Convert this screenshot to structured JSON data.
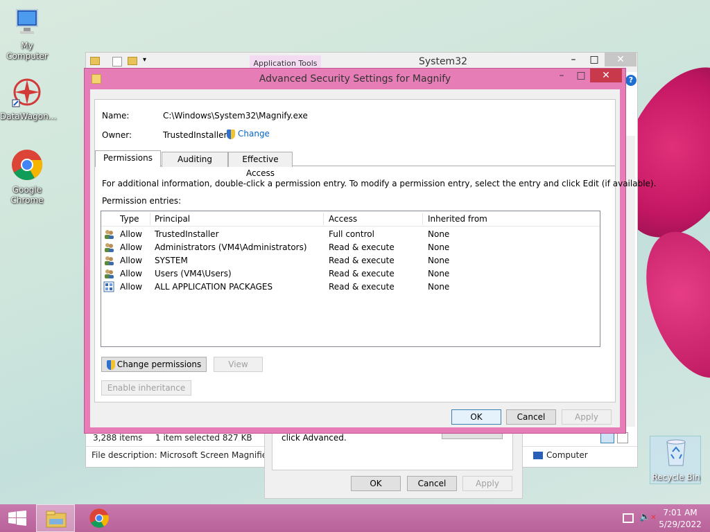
{
  "desktop": {
    "icons": [
      {
        "label": "My Computer",
        "icon": "computer-icon"
      },
      {
        "label": "DataWagon…",
        "icon": "datawagon-icon"
      },
      {
        "label": "Google Chrome",
        "icon": "chrome-icon"
      },
      {
        "label": "Recycle Bin",
        "icon": "recycle-bin-icon"
      }
    ]
  },
  "explorer": {
    "title": "System32",
    "ribbon_context": "Application Tools",
    "status_items": "3,288 items",
    "status_selected": "1 item selected  827 KB",
    "file_description": "File description: Microsoft Screen Magnifier, Co",
    "location": "Computer"
  },
  "properties_dialog": {
    "hint": "click Advanced.",
    "ok": "OK",
    "cancel": "Cancel",
    "apply": "Apply"
  },
  "dialog": {
    "title": "Advanced Security Settings for Magnify",
    "name_label": "Name:",
    "name_value": "C:\\Windows\\System32\\Magnify.exe",
    "owner_label": "Owner:",
    "owner_value": "TrustedInstaller",
    "change_link": "Change",
    "tabs": [
      "Permissions",
      "Auditing",
      "Effective Access"
    ],
    "info": "For additional information, double-click a permission entry. To modify a permission entry, select the entry and click Edit (if available).",
    "entries_label": "Permission entries:",
    "columns": [
      "Type",
      "Principal",
      "Access",
      "Inherited from"
    ],
    "rows": [
      {
        "type": "Allow",
        "principal": "TrustedInstaller",
        "access": "Full control",
        "inherited": "None",
        "icon": "users-icon"
      },
      {
        "type": "Allow",
        "principal": "Administrators (VM4\\Administrators)",
        "access": "Read & execute",
        "inherited": "None",
        "icon": "users-icon"
      },
      {
        "type": "Allow",
        "principal": "SYSTEM",
        "access": "Read & execute",
        "inherited": "None",
        "icon": "users-icon"
      },
      {
        "type": "Allow",
        "principal": "Users (VM4\\Users)",
        "access": "Read & execute",
        "inherited": "None",
        "icon": "users-icon"
      },
      {
        "type": "Allow",
        "principal": "ALL APPLICATION PACKAGES",
        "access": "Read & execute",
        "inherited": "None",
        "icon": "app-packages-icon"
      }
    ],
    "change_permissions": "Change permissions",
    "view": "View",
    "enable_inheritance": "Enable inheritance",
    "ok": "OK",
    "cancel": "Cancel",
    "apply": "Apply"
  },
  "taskbar": {
    "time": "7:01 AM",
    "date": "5/29/2022"
  },
  "colors": {
    "accent": "#e67db6",
    "taskbar": "#c06fa4",
    "selection_border": "#3c7fb1"
  }
}
